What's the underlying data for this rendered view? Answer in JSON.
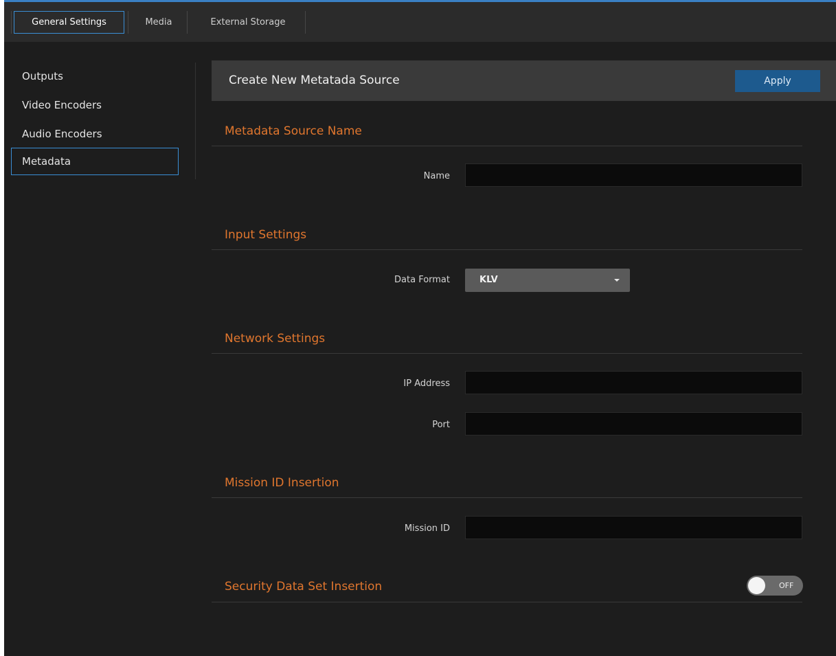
{
  "tabs": [
    {
      "label": "General Settings",
      "active": true
    },
    {
      "label": "Media",
      "active": false
    },
    {
      "label": "External Storage",
      "active": false
    }
  ],
  "sidebar": {
    "items": [
      {
        "label": "Outputs",
        "active": false
      },
      {
        "label": "Video Encoders",
        "active": false
      },
      {
        "label": "Audio Encoders",
        "active": false
      },
      {
        "label": "Metadata",
        "active": true
      }
    ]
  },
  "panel": {
    "title": "Create New Metatada Source",
    "apply_label": "Apply"
  },
  "sections": {
    "source_name": {
      "title": "Metadata Source Name",
      "name_label": "Name",
      "name_value": ""
    },
    "input": {
      "title": "Input Settings",
      "data_format_label": "Data Format",
      "data_format_value": "KLV"
    },
    "network": {
      "title": "Network Settings",
      "ip_label": "IP Address",
      "ip_value": "",
      "port_label": "Port",
      "port_value": ""
    },
    "mission": {
      "title": "Mission ID Insertion",
      "mission_label": "Mission ID",
      "mission_value": ""
    },
    "security": {
      "title": "Security Data Set Insertion",
      "toggle_state": "OFF"
    }
  },
  "colors": {
    "accent": "#3a8fd6",
    "section_title": "#e0762e",
    "apply_button": "#1d5a8e"
  }
}
